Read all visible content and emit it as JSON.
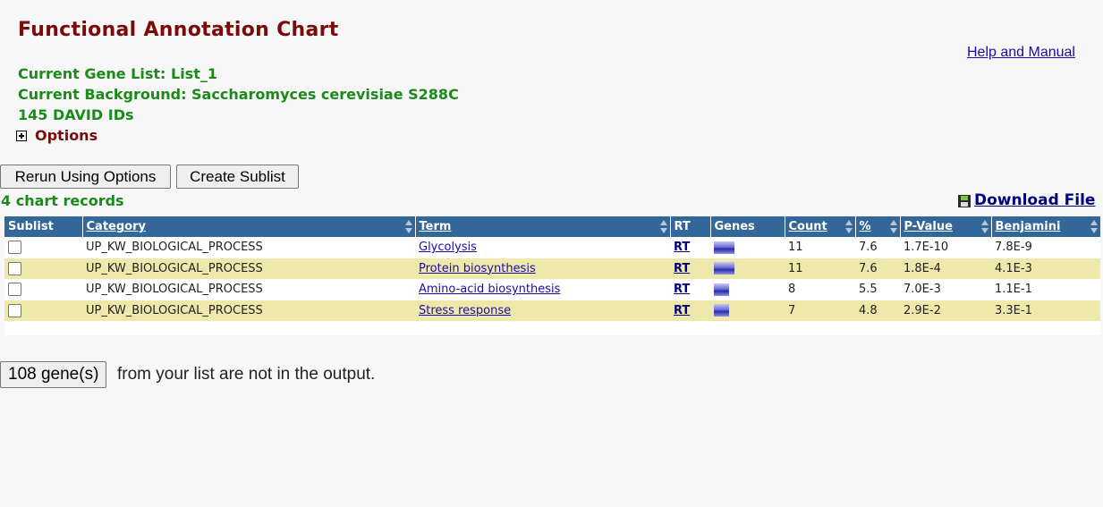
{
  "title": "Functional Annotation Chart",
  "help_link": "Help and Manual",
  "info": {
    "gene_list": "Current Gene List: List_1",
    "background": "Current Background: Saccharomyces cerevisiae S288C",
    "ids": "145 DAVID IDs"
  },
  "options_label": "Options",
  "buttons": {
    "rerun": "Rerun Using Options",
    "sublist": "Create Sublist"
  },
  "records_label": "4 chart records",
  "download_label": "Download File",
  "table": {
    "headers": {
      "sublist": "Sublist",
      "category": "Category",
      "term": "Term",
      "rt": "RT",
      "genes": "Genes",
      "count": "Count",
      "percent": "%",
      "pvalue": "P-Value",
      "benjamini": "Benjamini"
    },
    "rows": [
      {
        "category": "UP_KW_BIOLOGICAL_PROCESS",
        "term": "Glycolysis",
        "rt": "RT",
        "count": "11",
        "percent": "7.6",
        "pvalue": "1.7E-10",
        "benjamini": "7.8E-9"
      },
      {
        "category": "UP_KW_BIOLOGICAL_PROCESS",
        "term": "Protein biosynthesis",
        "rt": "RT",
        "count": "11",
        "percent": "7.6",
        "pvalue": "1.8E-4",
        "benjamini": "4.1E-3"
      },
      {
        "category": "UP_KW_BIOLOGICAL_PROCESS",
        "term": "Amino-acid biosynthesis",
        "rt": "RT",
        "count": "8",
        "percent": "5.5",
        "pvalue": "7.0E-3",
        "benjamini": "1.1E-1"
      },
      {
        "category": "UP_KW_BIOLOGICAL_PROCESS",
        "term": "Stress response",
        "rt": "RT",
        "count": "7",
        "percent": "4.8",
        "pvalue": "2.9E-2",
        "benjamini": "3.3E-1"
      }
    ]
  },
  "footer": {
    "button": "108 gene(s)",
    "text": "from your list are not in the output."
  },
  "colors": {
    "title": "#7a0b0b",
    "info": "#1b8a1b",
    "header_bg": "#336699",
    "row_alt": "#eee8aa"
  }
}
